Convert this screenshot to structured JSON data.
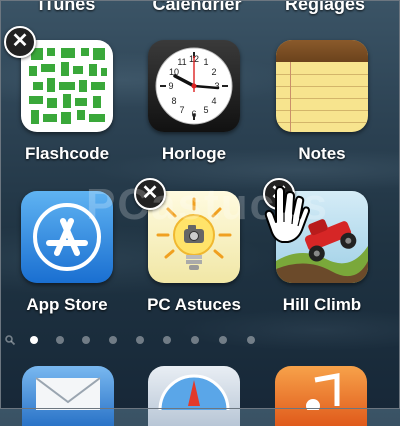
{
  "top_row": [
    "iTunes",
    "Calendrier",
    "Réglages"
  ],
  "apps": [
    {
      "label": "Flashcode",
      "icon": "qr-code-icon",
      "deletable": true
    },
    {
      "label": "Horloge",
      "icon": "clock-icon",
      "deletable": false
    },
    {
      "label": "Notes",
      "icon": "notepad-icon",
      "deletable": false
    },
    {
      "label": "App Store",
      "icon": "app-store-icon",
      "deletable": false
    },
    {
      "label": "PC Astuces",
      "icon": "lightbulb-camera-icon",
      "deletable": true
    },
    {
      "label": "Hill Climb",
      "icon": "hill-climb-car-icon",
      "deletable": true
    }
  ],
  "delete_glyph": "✕",
  "page_indicator": {
    "pages": 9,
    "active": 1
  },
  "watermark": "PCastuces",
  "dock": [
    "mail-icon",
    "safari-icon",
    "music-icon"
  ]
}
